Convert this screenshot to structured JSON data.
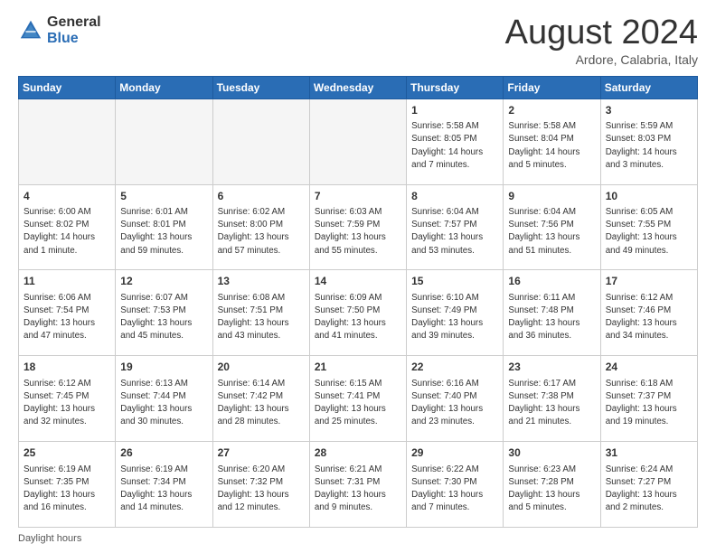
{
  "logo": {
    "general": "General",
    "blue": "Blue"
  },
  "header": {
    "month": "August 2024",
    "location": "Ardore, Calabria, Italy"
  },
  "weekdays": [
    "Sunday",
    "Monday",
    "Tuesday",
    "Wednesday",
    "Thursday",
    "Friday",
    "Saturday"
  ],
  "footer": "Daylight hours",
  "weeks": [
    [
      {
        "day": "",
        "info": ""
      },
      {
        "day": "",
        "info": ""
      },
      {
        "day": "",
        "info": ""
      },
      {
        "day": "",
        "info": ""
      },
      {
        "day": "1",
        "info": "Sunrise: 5:58 AM\nSunset: 8:05 PM\nDaylight: 14 hours\nand 7 minutes."
      },
      {
        "day": "2",
        "info": "Sunrise: 5:58 AM\nSunset: 8:04 PM\nDaylight: 14 hours\nand 5 minutes."
      },
      {
        "day": "3",
        "info": "Sunrise: 5:59 AM\nSunset: 8:03 PM\nDaylight: 14 hours\nand 3 minutes."
      }
    ],
    [
      {
        "day": "4",
        "info": "Sunrise: 6:00 AM\nSunset: 8:02 PM\nDaylight: 14 hours\nand 1 minute."
      },
      {
        "day": "5",
        "info": "Sunrise: 6:01 AM\nSunset: 8:01 PM\nDaylight: 13 hours\nand 59 minutes."
      },
      {
        "day": "6",
        "info": "Sunrise: 6:02 AM\nSunset: 8:00 PM\nDaylight: 13 hours\nand 57 minutes."
      },
      {
        "day": "7",
        "info": "Sunrise: 6:03 AM\nSunset: 7:59 PM\nDaylight: 13 hours\nand 55 minutes."
      },
      {
        "day": "8",
        "info": "Sunrise: 6:04 AM\nSunset: 7:57 PM\nDaylight: 13 hours\nand 53 minutes."
      },
      {
        "day": "9",
        "info": "Sunrise: 6:04 AM\nSunset: 7:56 PM\nDaylight: 13 hours\nand 51 minutes."
      },
      {
        "day": "10",
        "info": "Sunrise: 6:05 AM\nSunset: 7:55 PM\nDaylight: 13 hours\nand 49 minutes."
      }
    ],
    [
      {
        "day": "11",
        "info": "Sunrise: 6:06 AM\nSunset: 7:54 PM\nDaylight: 13 hours\nand 47 minutes."
      },
      {
        "day": "12",
        "info": "Sunrise: 6:07 AM\nSunset: 7:53 PM\nDaylight: 13 hours\nand 45 minutes."
      },
      {
        "day": "13",
        "info": "Sunrise: 6:08 AM\nSunset: 7:51 PM\nDaylight: 13 hours\nand 43 minutes."
      },
      {
        "day": "14",
        "info": "Sunrise: 6:09 AM\nSunset: 7:50 PM\nDaylight: 13 hours\nand 41 minutes."
      },
      {
        "day": "15",
        "info": "Sunrise: 6:10 AM\nSunset: 7:49 PM\nDaylight: 13 hours\nand 39 minutes."
      },
      {
        "day": "16",
        "info": "Sunrise: 6:11 AM\nSunset: 7:48 PM\nDaylight: 13 hours\nand 36 minutes."
      },
      {
        "day": "17",
        "info": "Sunrise: 6:12 AM\nSunset: 7:46 PM\nDaylight: 13 hours\nand 34 minutes."
      }
    ],
    [
      {
        "day": "18",
        "info": "Sunrise: 6:12 AM\nSunset: 7:45 PM\nDaylight: 13 hours\nand 32 minutes."
      },
      {
        "day": "19",
        "info": "Sunrise: 6:13 AM\nSunset: 7:44 PM\nDaylight: 13 hours\nand 30 minutes."
      },
      {
        "day": "20",
        "info": "Sunrise: 6:14 AM\nSunset: 7:42 PM\nDaylight: 13 hours\nand 28 minutes."
      },
      {
        "day": "21",
        "info": "Sunrise: 6:15 AM\nSunset: 7:41 PM\nDaylight: 13 hours\nand 25 minutes."
      },
      {
        "day": "22",
        "info": "Sunrise: 6:16 AM\nSunset: 7:40 PM\nDaylight: 13 hours\nand 23 minutes."
      },
      {
        "day": "23",
        "info": "Sunrise: 6:17 AM\nSunset: 7:38 PM\nDaylight: 13 hours\nand 21 minutes."
      },
      {
        "day": "24",
        "info": "Sunrise: 6:18 AM\nSunset: 7:37 PM\nDaylight: 13 hours\nand 19 minutes."
      }
    ],
    [
      {
        "day": "25",
        "info": "Sunrise: 6:19 AM\nSunset: 7:35 PM\nDaylight: 13 hours\nand 16 minutes."
      },
      {
        "day": "26",
        "info": "Sunrise: 6:19 AM\nSunset: 7:34 PM\nDaylight: 13 hours\nand 14 minutes."
      },
      {
        "day": "27",
        "info": "Sunrise: 6:20 AM\nSunset: 7:32 PM\nDaylight: 13 hours\nand 12 minutes."
      },
      {
        "day": "28",
        "info": "Sunrise: 6:21 AM\nSunset: 7:31 PM\nDaylight: 13 hours\nand 9 minutes."
      },
      {
        "day": "29",
        "info": "Sunrise: 6:22 AM\nSunset: 7:30 PM\nDaylight: 13 hours\nand 7 minutes."
      },
      {
        "day": "30",
        "info": "Sunrise: 6:23 AM\nSunset: 7:28 PM\nDaylight: 13 hours\nand 5 minutes."
      },
      {
        "day": "31",
        "info": "Sunrise: 6:24 AM\nSunset: 7:27 PM\nDaylight: 13 hours\nand 2 minutes."
      }
    ]
  ]
}
